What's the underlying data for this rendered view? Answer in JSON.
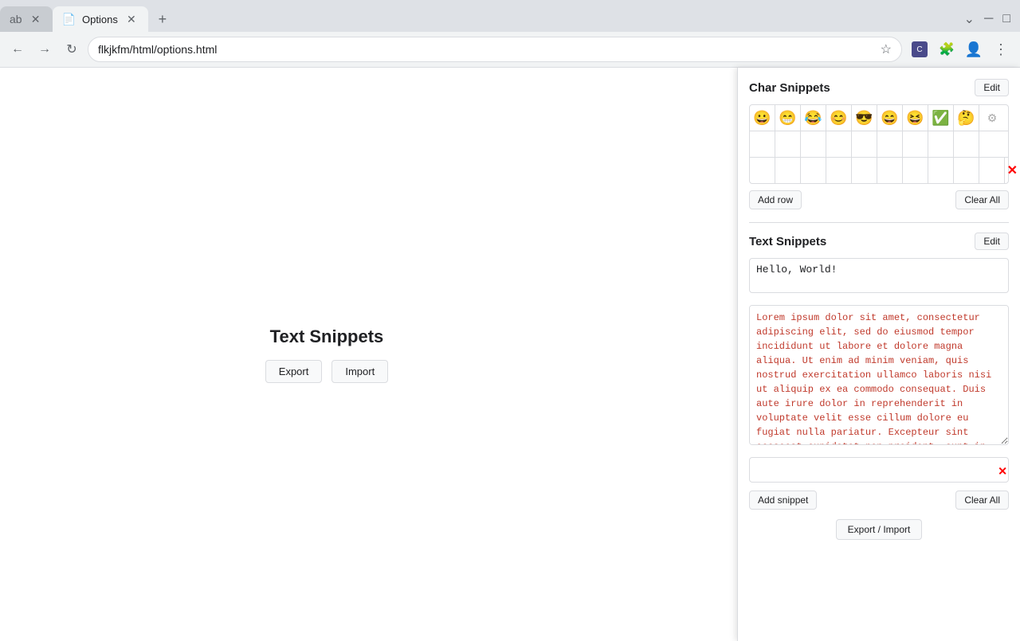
{
  "browser": {
    "tab_inactive_label": "ab",
    "tab_active_label": "Options",
    "new_tab_label": "+",
    "address_url": "flkjkfm/html/options.html",
    "tab_inactive_close": "✕",
    "tab_active_close": "✕"
  },
  "popup": {
    "char_snippets": {
      "title": "Char Snippets",
      "edit_label": "Edit",
      "clear_all_label": "Clear All",
      "add_row_label": "Add row",
      "emojis_row1": [
        "😀",
        "😁",
        "😂",
        "😊",
        "😎",
        "😄",
        "😆",
        "✅",
        "🤔",
        "⚙"
      ],
      "emojis_row2": [
        "",
        "",
        "",
        "",
        "",
        "",
        "",
        "",
        "",
        ""
      ],
      "emojis_row3": [
        "",
        "",
        "",
        "",
        "",
        "",
        "",
        "",
        "",
        ""
      ]
    },
    "text_snippets": {
      "title": "Text Snippets",
      "edit_label": "Edit",
      "clear_all_label": "Clear All",
      "add_snippet_label": "Add snippet",
      "export_import_label": "Export / Import",
      "snippet1_value": "Hello, World!",
      "snippet2_value": "Lorem ipsum dolor sit amet, consectetur adipiscing elit, sed do eiusmod tempor incididunt ut labore et dolore magna aliqua. Ut enim ad minim veniam, quis nostrud exercitation ullamco laboris nisi ut aliquip ex ea commodo consequat. Duis aute irure dolor in reprehenderit in voluptate velit esse cillum dolore eu fugiat nulla pariatur. Excepteur sint occaecat cupidatat non proident, sunt in culpa qui officia deserunt mollit anim id est laborum.",
      "snippet3_value": ""
    }
  },
  "page_content": {
    "title": "Text Snippets",
    "export_label": "Export",
    "import_label": "Import"
  }
}
